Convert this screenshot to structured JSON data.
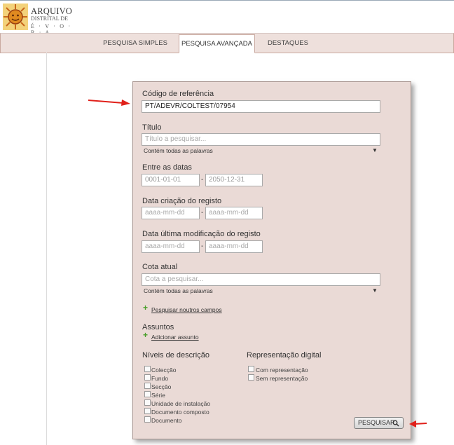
{
  "header": {
    "logo_line1": "ARQUIVO",
    "logo_line2": "DISTRITAL DE",
    "logo_line3": "É · V · O · R · A"
  },
  "nav": {
    "tabs": [
      {
        "label": "PESQUISA SIMPLES"
      },
      {
        "label": "PESQUISA AVANÇADA"
      },
      {
        "label": "DESTAQUES"
      }
    ],
    "active": "PESQUISA AVANÇADA"
  },
  "form": {
    "ref": {
      "label": "Código de referência",
      "value": "PT/ADEVR/COLTEST/07954"
    },
    "titulo": {
      "label": "Título",
      "placeholder": "Título a pesquisar...",
      "mode": "Contém todas as palavras"
    },
    "datas": {
      "label": "Entre as datas",
      "from": "0001-01-01",
      "to": "2050-12-31",
      "sep": "-"
    },
    "criacao": {
      "label": "Data criação do registo",
      "from": "aaaa-mm-dd",
      "to": "aaaa-mm-dd",
      "sep": "-"
    },
    "modificacao": {
      "label": "Data última modificação do registo",
      "from": "aaaa-mm-dd",
      "to": "aaaa-mm-dd",
      "sep": "-"
    },
    "cota": {
      "label": "Cota atual",
      "placeholder": "Cota a pesquisar...",
      "mode": "Contém todas as palavras"
    },
    "outros_campos": "Pesquisar noutros campos",
    "assuntos": {
      "label": "Assuntos",
      "add": "Adicionar assunto"
    },
    "niveis": {
      "label": "Níveis de descrição",
      "items": [
        "Colecção",
        "Fundo",
        "Secção",
        "Série",
        "Unidade de instalação",
        "Documento composto",
        "Documento"
      ]
    },
    "representacao": {
      "label": "Representação digital",
      "items": [
        "Com representação",
        "Sem representação"
      ]
    },
    "submit": "PESQUISAR"
  },
  "colors": {
    "panel_bg": "#eadad6",
    "nav_bg": "#eee0dc",
    "accent_red": "#e0201a",
    "plus_green": "#4aa02c"
  }
}
